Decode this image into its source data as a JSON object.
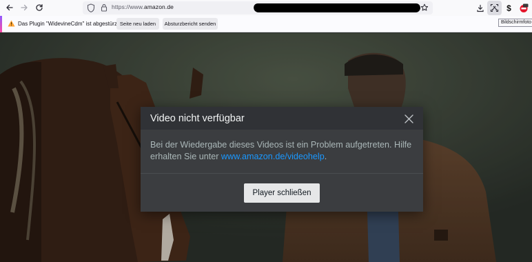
{
  "toolbar": {
    "url_prefix": "https://www.",
    "url_host": "amazon.de",
    "back_icon": "arrow-left-icon",
    "forward_icon": "arrow-right-icon",
    "reload_icon": "reload-icon",
    "tooltip": "Bildschirmfoto"
  },
  "notification": {
    "message": "Das Plugin \"WidevineCdm\" ist abgestürzt.",
    "reload_button": "Seite neu laden",
    "report_button": "Absturzbericht senden"
  },
  "dialog": {
    "title": "Video nicht verfügbar",
    "body": "Bei der Wiedergabe dieses Videos ist ein Problem aufgetreten. Hilfe erhalten Sie unter ",
    "link": "www.amazon.de/videohelp",
    "body_end": ".",
    "button": "Player schließen"
  },
  "colors": {
    "link": "#1a98ff",
    "dialog_bg": "#3b3d40",
    "warning": "#ffa436"
  }
}
